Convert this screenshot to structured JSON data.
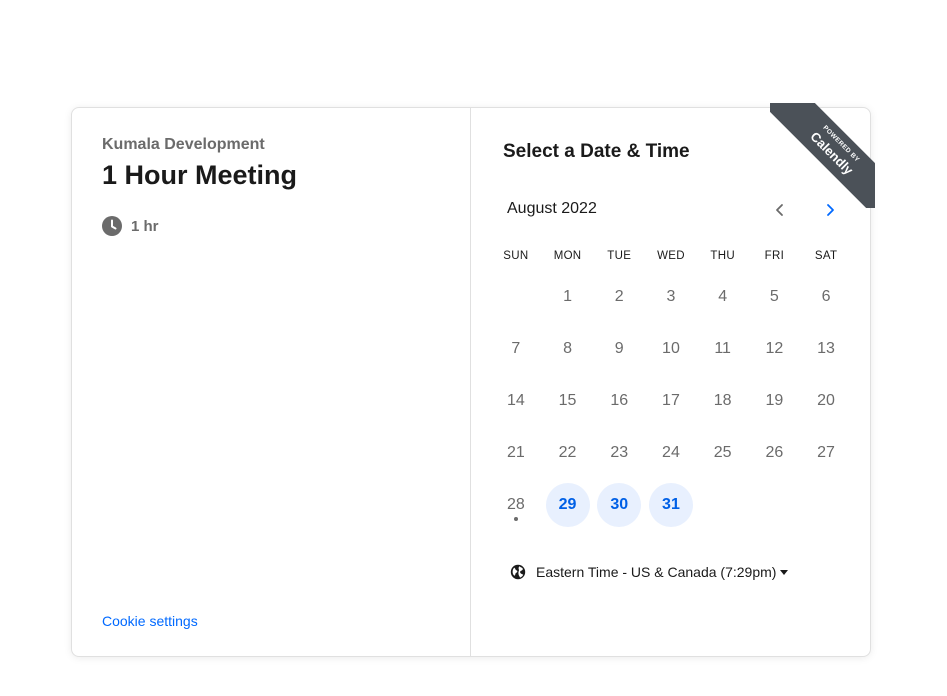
{
  "left": {
    "organization": "Kumala Development",
    "event_name": "1 Hour Meeting",
    "duration": "1 hr",
    "duration_icon": "clock-icon",
    "cookie_settings": "Cookie settings"
  },
  "right": {
    "heading": "Select a Date & Time",
    "month_label": "August 2022",
    "prev_icon": "chevron-left-icon",
    "next_icon": "chevron-right-icon",
    "weekdays": [
      "SUN",
      "MON",
      "TUE",
      "WED",
      "THU",
      "FRI",
      "SAT"
    ],
    "days": [
      {
        "label": "",
        "state": "empty"
      },
      {
        "label": "1",
        "state": "unavailable"
      },
      {
        "label": "2",
        "state": "unavailable"
      },
      {
        "label": "3",
        "state": "unavailable"
      },
      {
        "label": "4",
        "state": "unavailable"
      },
      {
        "label": "5",
        "state": "unavailable"
      },
      {
        "label": "6",
        "state": "unavailable"
      },
      {
        "label": "7",
        "state": "unavailable"
      },
      {
        "label": "8",
        "state": "unavailable"
      },
      {
        "label": "9",
        "state": "unavailable"
      },
      {
        "label": "10",
        "state": "unavailable"
      },
      {
        "label": "11",
        "state": "unavailable"
      },
      {
        "label": "12",
        "state": "unavailable"
      },
      {
        "label": "13",
        "state": "unavailable"
      },
      {
        "label": "14",
        "state": "unavailable"
      },
      {
        "label": "15",
        "state": "unavailable"
      },
      {
        "label": "16",
        "state": "unavailable"
      },
      {
        "label": "17",
        "state": "unavailable"
      },
      {
        "label": "18",
        "state": "unavailable"
      },
      {
        "label": "19",
        "state": "unavailable"
      },
      {
        "label": "20",
        "state": "unavailable"
      },
      {
        "label": "21",
        "state": "unavailable"
      },
      {
        "label": "22",
        "state": "unavailable"
      },
      {
        "label": "23",
        "state": "unavailable"
      },
      {
        "label": "24",
        "state": "unavailable"
      },
      {
        "label": "25",
        "state": "unavailable"
      },
      {
        "label": "26",
        "state": "unavailable"
      },
      {
        "label": "27",
        "state": "unavailable"
      },
      {
        "label": "28",
        "state": "today"
      },
      {
        "label": "29",
        "state": "available"
      },
      {
        "label": "30",
        "state": "available"
      },
      {
        "label": "31",
        "state": "available"
      }
    ],
    "timezone_icon": "globe-icon",
    "timezone": "Eastern Time - US & Canada (7:29pm)"
  },
  "ribbon": {
    "powered_by": "POWERED BY",
    "brand": "Calendly"
  },
  "colors": {
    "accent": "#0069ff",
    "available_bg": "#e8f0fe",
    "ribbon_bg": "#4b5158"
  }
}
